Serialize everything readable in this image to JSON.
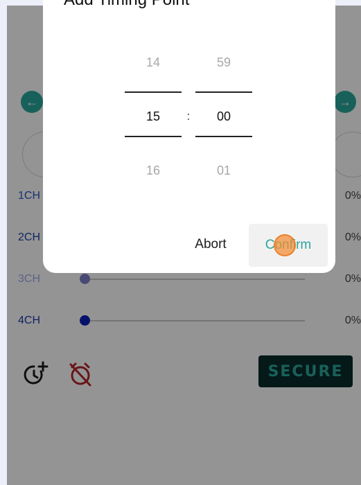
{
  "dialog": {
    "title": "Add Timing Point",
    "hours": {
      "prev": "14",
      "current": "15",
      "next": "16"
    },
    "minutes": {
      "prev": "59",
      "current": "00",
      "next": "01"
    },
    "separator": ":",
    "abort_label": "Abort",
    "confirm_label": "Confirm"
  },
  "channels": [
    {
      "label": "1CH",
      "value": "0%",
      "label_color": "#2e55c9",
      "knob_color": "#2e55c9"
    },
    {
      "label": "2CH",
      "value": "0%",
      "label_color": "#1a3fa8",
      "knob_color": "#1a3fa8"
    },
    {
      "label": "3CH",
      "value": "0%",
      "label_color": "#9fa8e8",
      "knob_color": "#7d80c8"
    },
    {
      "label": "4CH",
      "value": "0%",
      "label_color": "#1f3aa8",
      "knob_color": "#0d20b8"
    }
  ],
  "secure_label": "SECURE",
  "colors": {
    "accent": "#2aa79b",
    "alarm_off": "#b3262a"
  },
  "icons": {
    "nav_left": "arrow-left-icon",
    "nav_right": "arrow-right-icon",
    "add_timer": "add-timer-icon",
    "alarm_off": "alarm-off-icon"
  }
}
